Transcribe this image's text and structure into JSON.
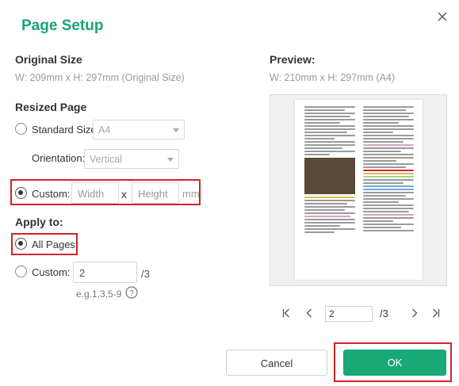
{
  "dialog": {
    "title": "Page Setup"
  },
  "original": {
    "heading": "Original Size",
    "size": "W: 209mm x H: 297mm (Original Size)"
  },
  "resized": {
    "heading": "Resized Page",
    "standard_label": "Standard Size:",
    "standard_value": "A4",
    "orientation_label": "Orientation:",
    "orientation_value": "Vertical",
    "custom_label": "Custom:",
    "width_placeholder": "Width",
    "x_sep": "x",
    "height_placeholder": "Height",
    "unit": "mm"
  },
  "apply": {
    "heading": "Apply to:",
    "all_label": "All Pages:",
    "custom_label": "Custom:",
    "custom_value": "2",
    "custom_total": "/3",
    "hint": "e.g.1,3,5-9",
    "help_icon": "question-circle-icon"
  },
  "preview": {
    "heading": "Preview:",
    "size": "W: 210mm x H: 297mm (A4)",
    "page_value": "2",
    "page_total": "/3"
  },
  "buttons": {
    "cancel": "Cancel",
    "ok": "OK"
  },
  "colors": {
    "accent": "#19a977",
    "highlight": "#d4232b"
  }
}
